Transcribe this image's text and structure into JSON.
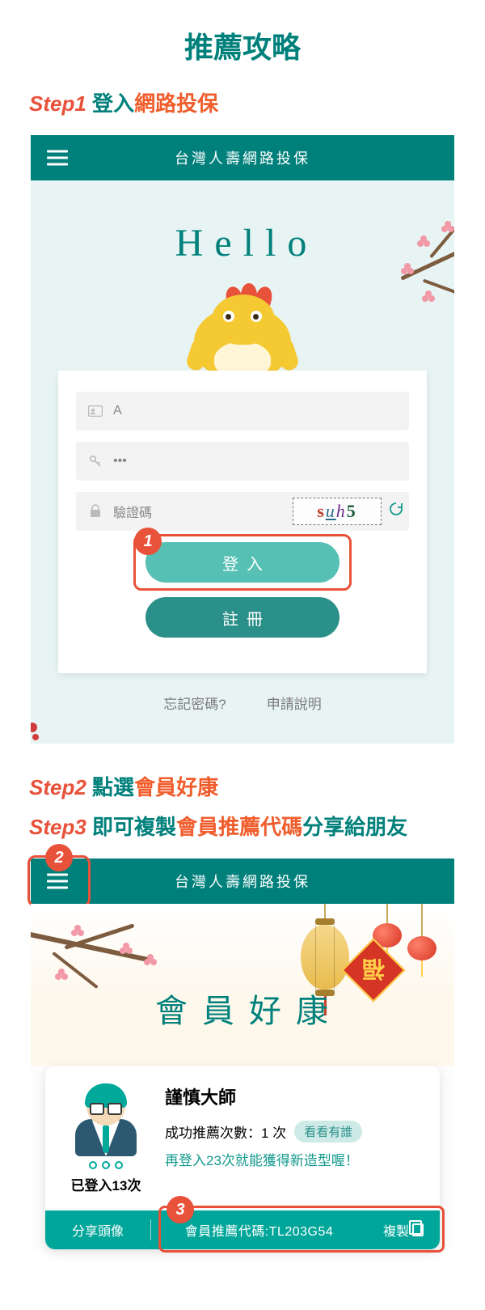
{
  "page_title": "推薦攻略",
  "steps": {
    "s1": {
      "num": "Step1",
      "text": "登入",
      "accent": "網路投保"
    },
    "s2": {
      "num": "Step2",
      "text": "點選",
      "accent": "會員好康"
    },
    "s3": {
      "num": "Step3",
      "text": "即可複製",
      "accent": "會員推薦代碼",
      "tail": "分享給朋友"
    }
  },
  "mock1": {
    "header_title": "台灣人壽網路投保",
    "hello": "Hello",
    "id_value": "A",
    "pw_value": "•••",
    "captcha_placeholder": "驗證碼",
    "captcha_chars": [
      "s",
      "u",
      "h",
      "5"
    ],
    "btn_login": "登入",
    "btn_register": "註冊",
    "link_forgot": "忘記密碼?",
    "link_apply": "申請說明",
    "marker": "1"
  },
  "mock2": {
    "header_title": "台灣人壽網路投保",
    "banner_title": "會員好康",
    "fu_char": "福",
    "marker_ham": "2",
    "user_name": "謹慎大師",
    "rec_label_pre": "成功推薦次數：",
    "rec_count": "1",
    "rec_label_post": "次",
    "see_who": "看看有誰",
    "hint": "再登入23次就能獲得新造型喔！",
    "avatar_logged_pre": "已登入",
    "avatar_logged_count": "13",
    "avatar_logged_post": "次",
    "share_avatar": "分享頭像",
    "code_label": "會員推薦代碼:",
    "code_value": "TL203G54",
    "copy_label": "複製",
    "marker_bottom": "3"
  }
}
